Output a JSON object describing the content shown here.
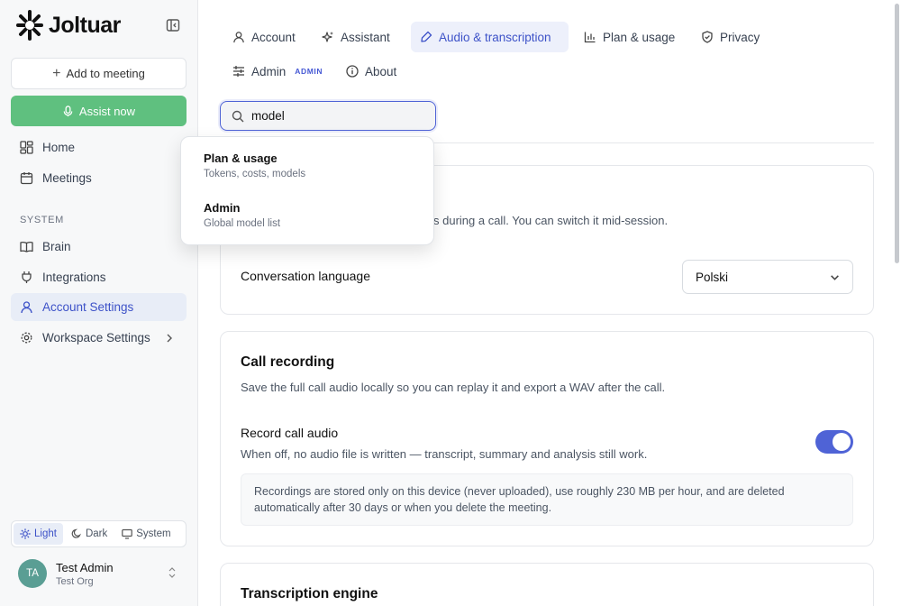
{
  "brand": {
    "name": "Joltuar"
  },
  "sidebar": {
    "add_meeting": "Add to meeting",
    "assist_now": "Assist now",
    "nav": [
      {
        "label": "Home"
      },
      {
        "label": "Meetings"
      }
    ],
    "section_label": "SYSTEM",
    "system_nav": [
      {
        "label": "Brain"
      },
      {
        "label": "Integrations"
      },
      {
        "label": "Account Settings"
      },
      {
        "label": "Workspace Settings"
      }
    ],
    "theme": {
      "light": "Light",
      "dark": "Dark",
      "system": "System",
      "selected": "Light"
    },
    "user": {
      "initials": "TA",
      "name": "Test Admin",
      "org": "Test Org"
    }
  },
  "tabs": [
    {
      "label": "Account"
    },
    {
      "label": "Assistant"
    },
    {
      "label": "Audio & transcription"
    },
    {
      "label": "Plan & usage"
    },
    {
      "label": "Privacy"
    },
    {
      "label": "Admin"
    },
    {
      "label": "About"
    }
  ],
  "admin_badge": "ADMIN",
  "active_tab": "Audio & transcription",
  "search": {
    "value": "model"
  },
  "search_results": [
    {
      "title": "Plan & usage",
      "subtitle": "Tokens, costs, models"
    },
    {
      "title": "Admin",
      "subtitle": "Global model list"
    }
  ],
  "cards": {
    "language": {
      "desc_visible": "s during a call. You can switch it mid-session.",
      "row_label": "Conversation language",
      "select_value": "Polski"
    },
    "recording": {
      "title": "Call recording",
      "desc": "Save the full call audio locally so you can replay it and export a WAV after the call.",
      "row_label": "Record call audio",
      "row_desc": "When off, no audio file is written — transcript, summary and analysis still work.",
      "toggle_on": true,
      "note_line1": "Recordings are stored only on this device (never uploaded), use roughly 230 MB per hour, and are deleted",
      "note_line2": "automatically after 30 days or when you delete the meeting."
    },
    "transcription": {
      "title": "Transcription engine"
    }
  },
  "colors": {
    "accent": "#4f63d6",
    "assist_green": "#5fc07f",
    "avatar": "#5a9e94"
  }
}
